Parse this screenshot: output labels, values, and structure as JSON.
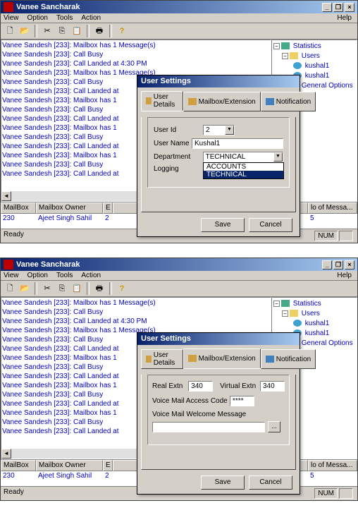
{
  "app_title": "Vanee Sancharak",
  "menu": {
    "view": "View",
    "option": "Option",
    "tools": "Tools",
    "action": "Action",
    "help": "Help"
  },
  "log": {
    "prefix": "Vanee Sandesh [233]:",
    "msgs": [
      "Mailbox has 1 Message(s)",
      "Call Busy",
      "Call Landed at 4:30 PM",
      "Mailbox has 1 Message(s)",
      "Call Busy",
      "Call Landed at",
      "Mailbox has 1",
      "Call Busy",
      "Call Landed at",
      "Mailbox has 1",
      "Call Busy",
      "Call Landed at",
      "Mailbox has 1",
      "Call Busy",
      "Call Landed at"
    ]
  },
  "tree": {
    "root": "Statistics",
    "users_label": "Users",
    "user1": "kushal1",
    "user2": "kushal1",
    "general": "General Options"
  },
  "table": {
    "cols": [
      "MailBox",
      "Mailbox Owner",
      "E",
      "lo of Messa..."
    ],
    "row": [
      "230",
      "Ajeet Singh Sahil",
      "2",
      "5"
    ]
  },
  "status": {
    "ready": "Ready",
    "num": "NUM"
  },
  "dialog": {
    "title": "User Settings",
    "tabs": {
      "user": "User Details",
      "mailbox": "Mailbox/Extension",
      "notification": "Notification"
    },
    "user_tab": {
      "userid_label": "User Id",
      "userid_value": "2",
      "username_label": "User Name",
      "username_value": "Kushal1",
      "dept_label": "Department",
      "dept_value": "TECHNICAL",
      "dept_options": [
        "ACCOUNTS",
        "TECHNICAL"
      ],
      "logging_label": "Logging"
    },
    "mailbox_tab": {
      "real_label": "Real Extn",
      "real_value": "340",
      "virt_label": "Virtual Extn",
      "virt_value": "340",
      "vmcode_label": "Voice Mail Access Code",
      "vmcode_value": "****",
      "welcome_label": "Voice Mail Welcome Message"
    },
    "save": "Save",
    "cancel": "Cancel"
  }
}
